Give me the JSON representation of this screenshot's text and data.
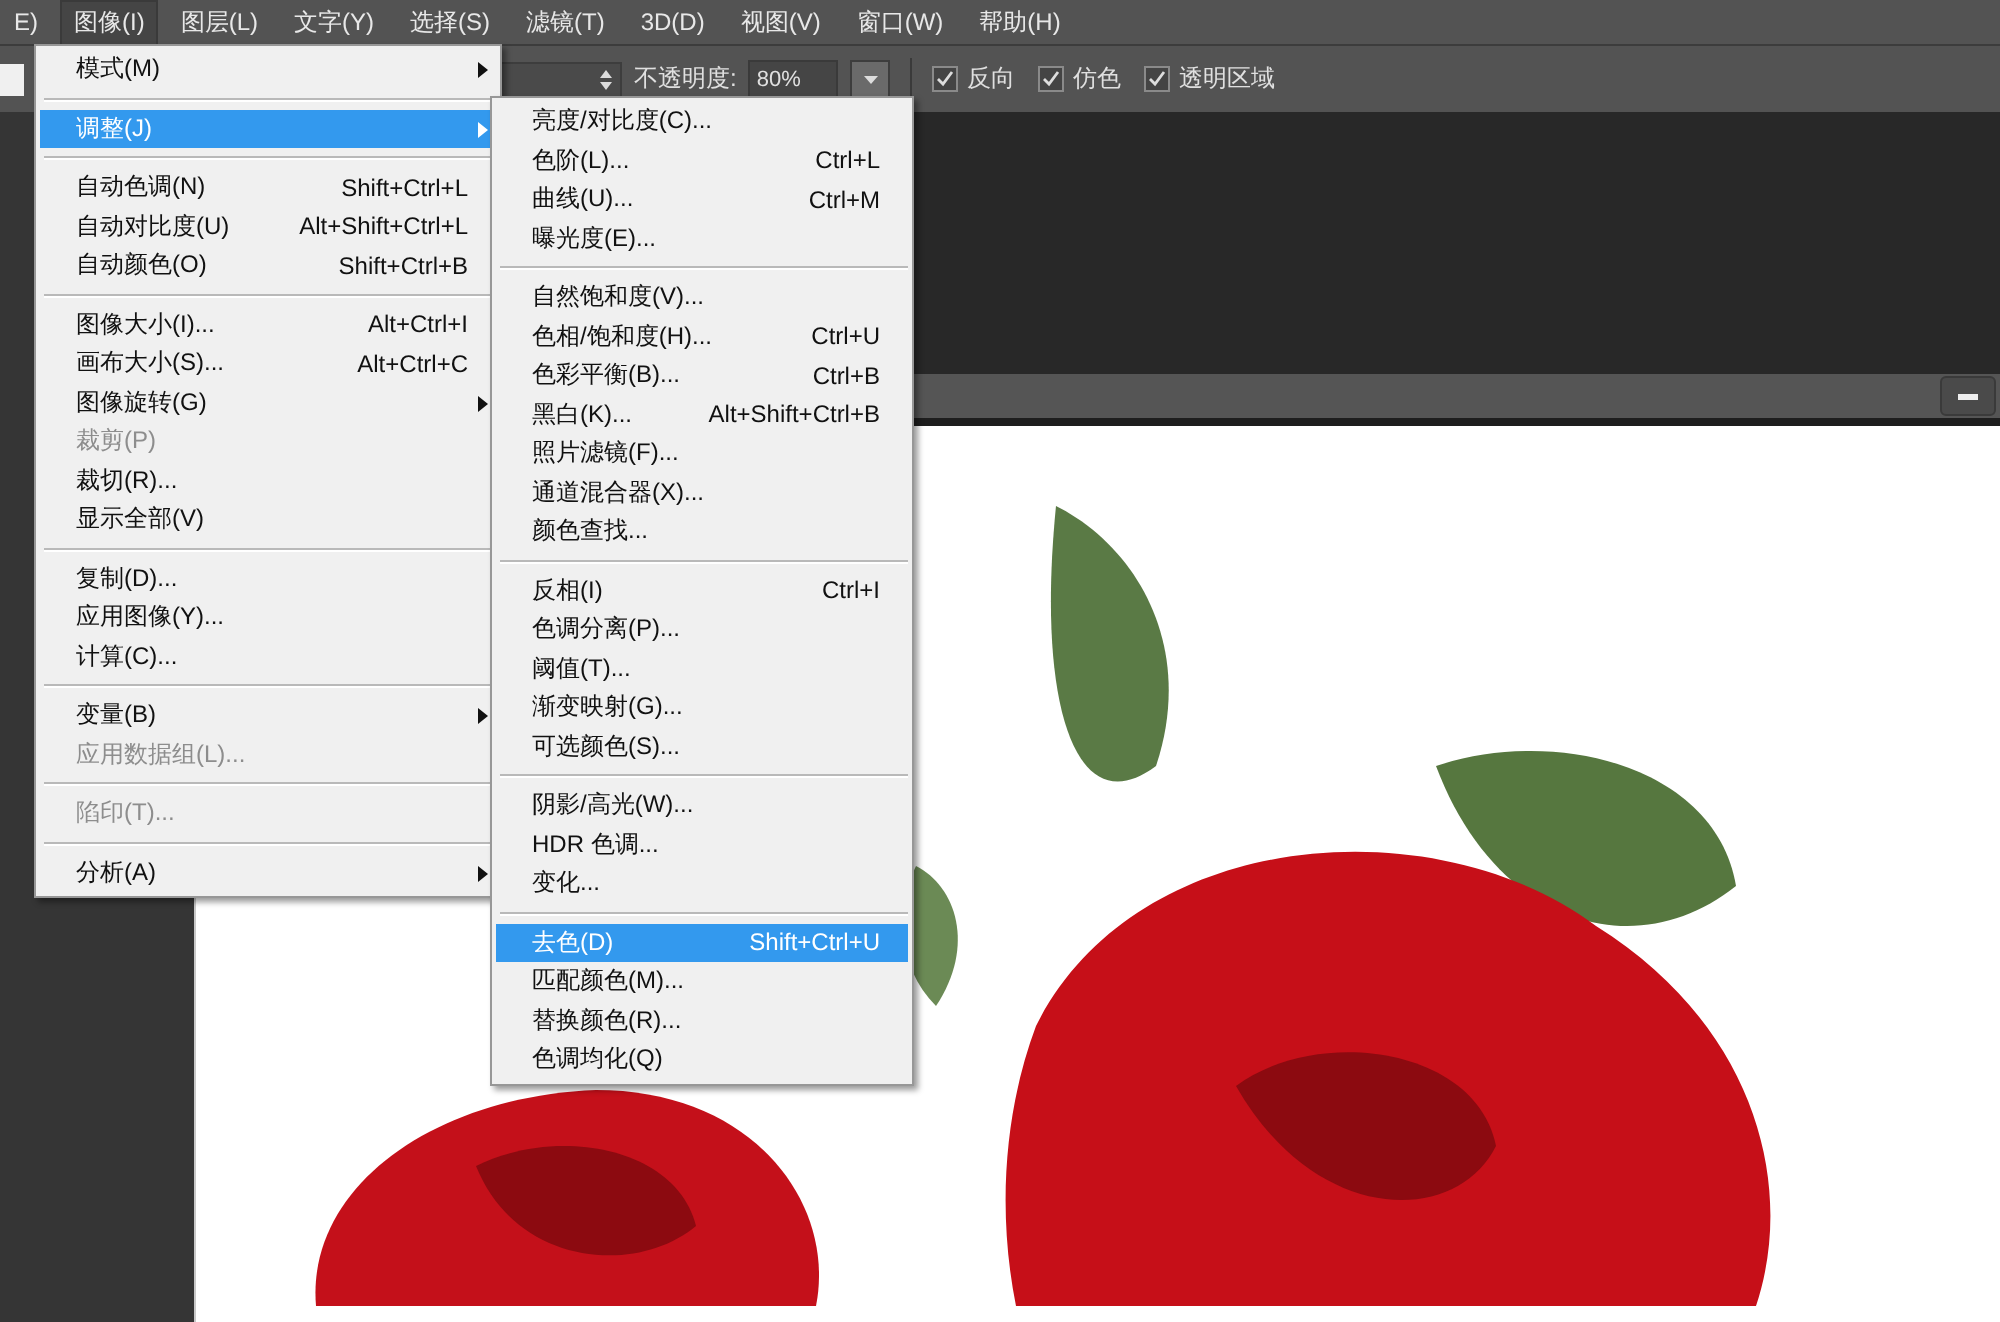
{
  "menu_bar": {
    "items": [
      {
        "label": "E)",
        "selected": false
      },
      {
        "label": "图像(I)",
        "selected": true
      },
      {
        "label": "图层(L)",
        "selected": false
      },
      {
        "label": "文字(Y)",
        "selected": false
      },
      {
        "label": "选择(S)",
        "selected": false
      },
      {
        "label": "滤镜(T)",
        "selected": false
      },
      {
        "label": "3D(D)",
        "selected": false
      },
      {
        "label": "视图(V)",
        "selected": false
      },
      {
        "label": "窗口(W)",
        "selected": false
      },
      {
        "label": "帮助(H)",
        "selected": false
      }
    ]
  },
  "options_bar": {
    "opacity_label": "不透明度:",
    "opacity_value": "80%",
    "checkboxes": [
      {
        "label": "反向",
        "checked": true
      },
      {
        "label": "仿色",
        "checked": true
      },
      {
        "label": "透明区域",
        "checked": true
      }
    ]
  },
  "image_menu": [
    {
      "kind": "item",
      "label": "模式(M)",
      "submenu": true,
      "disabled": false,
      "selected": false
    },
    {
      "kind": "separator"
    },
    {
      "kind": "item",
      "label": "调整(J)",
      "submenu": true,
      "disabled": false,
      "selected": true
    },
    {
      "kind": "separator"
    },
    {
      "kind": "item",
      "label": "自动色调(N)",
      "shortcut": "Shift+Ctrl+L",
      "submenu": false,
      "disabled": false,
      "selected": false
    },
    {
      "kind": "item",
      "label": "自动对比度(U)",
      "shortcut": "Alt+Shift+Ctrl+L",
      "submenu": false,
      "disabled": false,
      "selected": false
    },
    {
      "kind": "item",
      "label": "自动颜色(O)",
      "shortcut": "Shift+Ctrl+B",
      "submenu": false,
      "disabled": false,
      "selected": false
    },
    {
      "kind": "separator"
    },
    {
      "kind": "item",
      "label": "图像大小(I)...",
      "shortcut": "Alt+Ctrl+I",
      "submenu": false,
      "disabled": false,
      "selected": false
    },
    {
      "kind": "item",
      "label": "画布大小(S)...",
      "shortcut": "Alt+Ctrl+C",
      "submenu": false,
      "disabled": false,
      "selected": false
    },
    {
      "kind": "item",
      "label": "图像旋转(G)",
      "submenu": true,
      "disabled": false,
      "selected": false
    },
    {
      "kind": "item",
      "label": "裁剪(P)",
      "submenu": false,
      "disabled": true,
      "selected": false
    },
    {
      "kind": "item",
      "label": "裁切(R)...",
      "submenu": false,
      "disabled": false,
      "selected": false
    },
    {
      "kind": "item",
      "label": "显示全部(V)",
      "submenu": false,
      "disabled": false,
      "selected": false
    },
    {
      "kind": "separator"
    },
    {
      "kind": "item",
      "label": "复制(D)...",
      "submenu": false,
      "disabled": false,
      "selected": false
    },
    {
      "kind": "item",
      "label": "应用图像(Y)...",
      "submenu": false,
      "disabled": false,
      "selected": false
    },
    {
      "kind": "item",
      "label": "计算(C)...",
      "submenu": false,
      "disabled": false,
      "selected": false
    },
    {
      "kind": "separator"
    },
    {
      "kind": "item",
      "label": "变量(B)",
      "submenu": true,
      "disabled": false,
      "selected": false
    },
    {
      "kind": "item",
      "label": "应用数据组(L)...",
      "submenu": false,
      "disabled": true,
      "selected": false
    },
    {
      "kind": "separator"
    },
    {
      "kind": "item",
      "label": "陷印(T)...",
      "submenu": false,
      "disabled": true,
      "selected": false
    },
    {
      "kind": "separator"
    },
    {
      "kind": "item",
      "label": "分析(A)",
      "submenu": true,
      "disabled": false,
      "selected": false
    }
  ],
  "adjust_submenu": [
    {
      "kind": "item",
      "label": "亮度/对比度(C)...",
      "selected": false
    },
    {
      "kind": "item",
      "label": "色阶(L)...",
      "shortcut": "Ctrl+L",
      "selected": false
    },
    {
      "kind": "item",
      "label": "曲线(U)...",
      "shortcut": "Ctrl+M",
      "selected": false
    },
    {
      "kind": "item",
      "label": "曝光度(E)...",
      "selected": false
    },
    {
      "kind": "separator"
    },
    {
      "kind": "item",
      "label": "自然饱和度(V)...",
      "selected": false
    },
    {
      "kind": "item",
      "label": "色相/饱和度(H)...",
      "shortcut": "Ctrl+U",
      "selected": false
    },
    {
      "kind": "item",
      "label": "色彩平衡(B)...",
      "shortcut": "Ctrl+B",
      "selected": false
    },
    {
      "kind": "item",
      "label": "黑白(K)...",
      "shortcut": "Alt+Shift+Ctrl+B",
      "selected": false
    },
    {
      "kind": "item",
      "label": "照片滤镜(F)...",
      "selected": false
    },
    {
      "kind": "item",
      "label": "通道混合器(X)...",
      "selected": false
    },
    {
      "kind": "item",
      "label": "颜色查找...",
      "selected": false
    },
    {
      "kind": "separator"
    },
    {
      "kind": "item",
      "label": "反相(I)",
      "shortcut": "Ctrl+I",
      "selected": false
    },
    {
      "kind": "item",
      "label": "色调分离(P)...",
      "selected": false
    },
    {
      "kind": "item",
      "label": "阈值(T)...",
      "selected": false
    },
    {
      "kind": "item",
      "label": "渐变映射(G)...",
      "selected": false
    },
    {
      "kind": "item",
      "label": "可选颜色(S)...",
      "selected": false
    },
    {
      "kind": "separator"
    },
    {
      "kind": "item",
      "label": "阴影/高光(W)...",
      "selected": false
    },
    {
      "kind": "item",
      "label": "HDR 色调...",
      "selected": false
    },
    {
      "kind": "item",
      "label": "变化...",
      "selected": false
    },
    {
      "kind": "separator"
    },
    {
      "kind": "item",
      "label": "去色(D)",
      "shortcut": "Shift+Ctrl+U",
      "selected": true
    },
    {
      "kind": "item",
      "label": "匹配颜色(M)...",
      "selected": false
    },
    {
      "kind": "item",
      "label": "替换颜色(R)...",
      "selected": false
    },
    {
      "kind": "item",
      "label": "色调均化(Q)",
      "selected": false
    }
  ]
}
